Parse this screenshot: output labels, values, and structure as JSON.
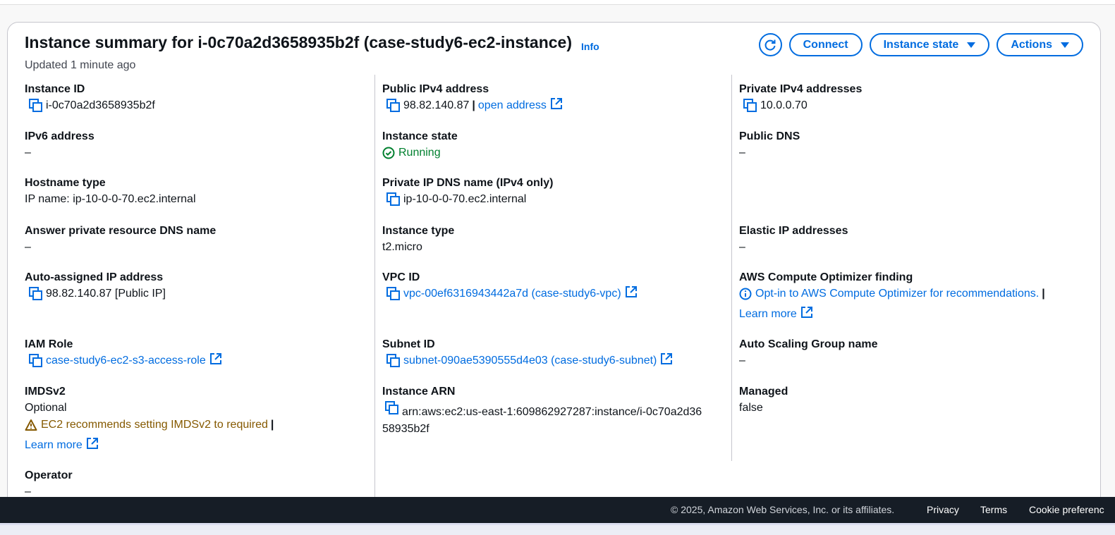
{
  "header": {
    "title": "Instance summary for i-0c70a2d3658935b2f (case-study6-ec2-instance)",
    "info": "Info",
    "updated": "Updated 1 minute ago",
    "connect": "Connect",
    "instance_state": "Instance state",
    "actions": "Actions"
  },
  "col1": {
    "instance_id": {
      "label": "Instance ID",
      "value": "i-0c70a2d3658935b2f"
    },
    "ipv6": {
      "label": "IPv6 address",
      "value": "–"
    },
    "hostname": {
      "label": "Hostname type",
      "value": "IP name: ip-10-0-0-70.ec2.internal"
    },
    "answer_dns": {
      "label": "Answer private resource DNS name",
      "value": "–"
    },
    "auto_ip": {
      "label": "Auto-assigned IP address",
      "value": "98.82.140.87 [Public IP]"
    },
    "iam_role": {
      "label": "IAM Role",
      "value": "case-study6-ec2-s3-access-role"
    },
    "imdsv2": {
      "label": "IMDSv2",
      "value": "Optional",
      "warning": "EC2 recommends setting IMDSv2 to required",
      "sep": "|",
      "learn_more": "Learn more"
    },
    "operator": {
      "label": "Operator",
      "value": "–"
    }
  },
  "col2": {
    "public_ipv4": {
      "label": "Public IPv4 address",
      "value": "98.82.140.87",
      "sep": "|",
      "open": "open address"
    },
    "instance_state": {
      "label": "Instance state",
      "value": "Running"
    },
    "private_dns": {
      "label": "Private IP DNS name (IPv4 only)",
      "value": "ip-10-0-0-70.ec2.internal"
    },
    "instance_type": {
      "label": "Instance type",
      "value": "t2.micro"
    },
    "vpc": {
      "label": "VPC ID",
      "value": "vpc-00ef6316943442a7d (case-study6-vpc)"
    },
    "subnet": {
      "label": "Subnet ID",
      "value": "subnet-090ae5390555d4e03 (case-study6-subnet)"
    },
    "arn": {
      "label": "Instance ARN",
      "value_line1": "arn:aws:ec2:us-east-1:609862927287:instance/i-0c70a2d36",
      "value_line2": "58935b2f"
    }
  },
  "col3": {
    "private_ipv4": {
      "label": "Private IPv4 addresses",
      "value": "10.0.0.70"
    },
    "public_dns": {
      "label": "Public DNS",
      "value": "–"
    },
    "elastic_ip": {
      "label": "Elastic IP addresses",
      "value": "–"
    },
    "optimizer": {
      "label": "AWS Compute Optimizer finding",
      "value": "Opt-in to AWS Compute Optimizer for recommendations.",
      "sep": "|",
      "learn_more": "Learn more"
    },
    "asg": {
      "label": "Auto Scaling Group name",
      "value": "–"
    },
    "managed": {
      "label": "Managed",
      "value": "false"
    }
  },
  "footer": {
    "copyright": "© 2025, Amazon Web Services, Inc. or its affiliates.",
    "privacy": "Privacy",
    "terms": "Terms",
    "cookies": "Cookie preferenc"
  },
  "colors": {
    "link": "#006ce0",
    "success": "#00802f",
    "warning": "#855900",
    "footer_bg": "#161d26"
  }
}
